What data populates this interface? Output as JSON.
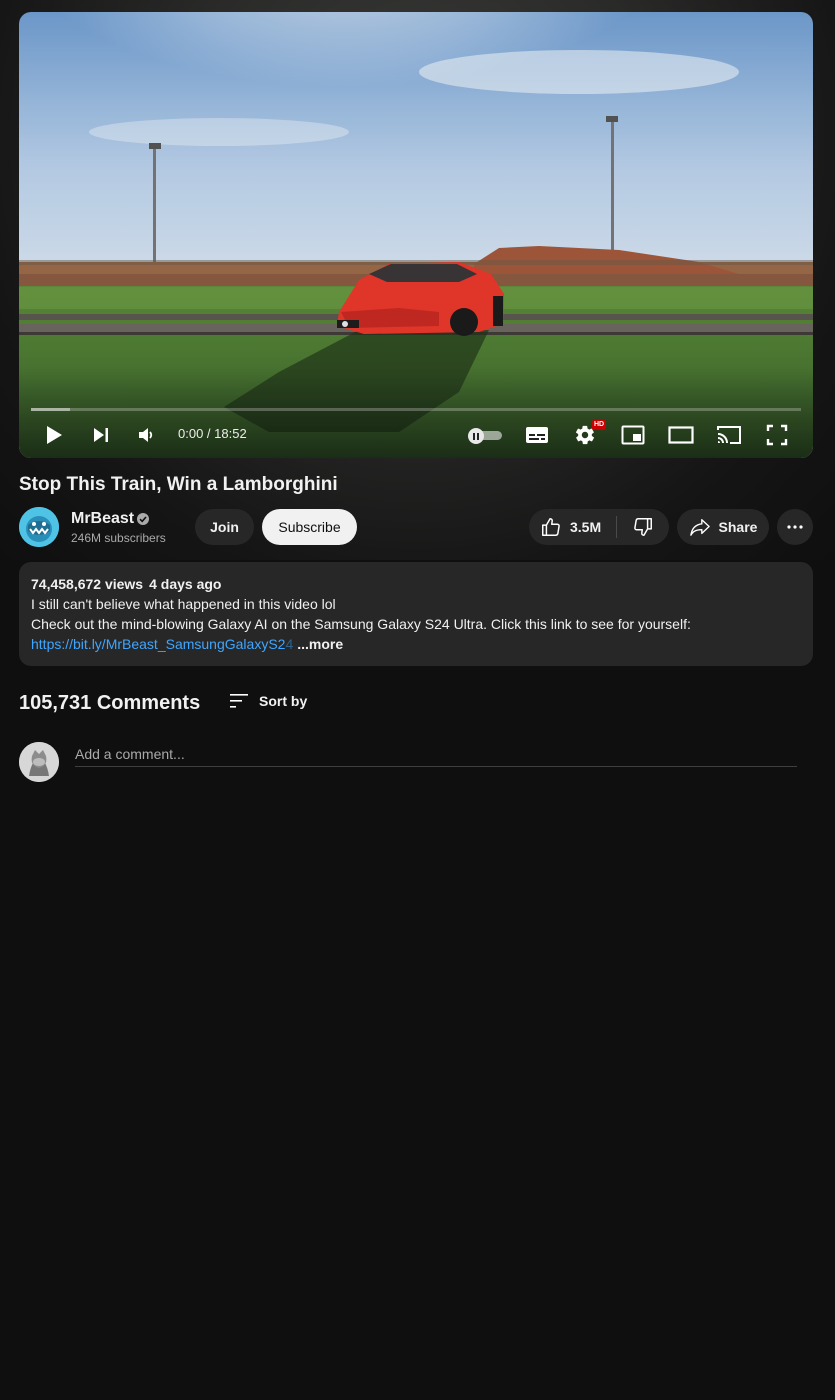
{
  "player": {
    "time_display": "0:00 / 18:52",
    "progress_loaded_fraction": 0.05,
    "hd_badge": "HD",
    "icons": [
      "play-icon",
      "next-icon",
      "volume-icon",
      "autoplay-toggle",
      "subtitles-icon",
      "settings-icon",
      "miniplayer-icon",
      "theater-icon",
      "cast-icon",
      "fullscreen-icon"
    ]
  },
  "video": {
    "title": "Stop This Train, Win a Lamborghini"
  },
  "channel": {
    "name": "MrBeast",
    "subscribers": "246M subscribers",
    "join_label": "Join",
    "subscribe_label": "Subscribe"
  },
  "actions": {
    "like_count": "3.5M",
    "share_label": "Share"
  },
  "description": {
    "views": "74,458,672 views",
    "age": "4 days ago",
    "line1": "I still can't believe what happened in this video lol",
    "line2": "Check out the mind-blowing Galaxy AI on the Samsung Galaxy S24 Ultra. Click this link to see for yourself:",
    "link": "https://bit.ly/MrBeast_SamsungGalaxyS2",
    "link_faded": "4",
    "more_label": "...more"
  },
  "comments": {
    "count_label": "105,731 Comments",
    "sort_label": "Sort by",
    "input_placeholder": "Add a comment..."
  },
  "colors": {
    "background": "#0f0f0f",
    "surface": "#272727",
    "link": "#3ea6ff",
    "hd_red": "#cc0000"
  }
}
